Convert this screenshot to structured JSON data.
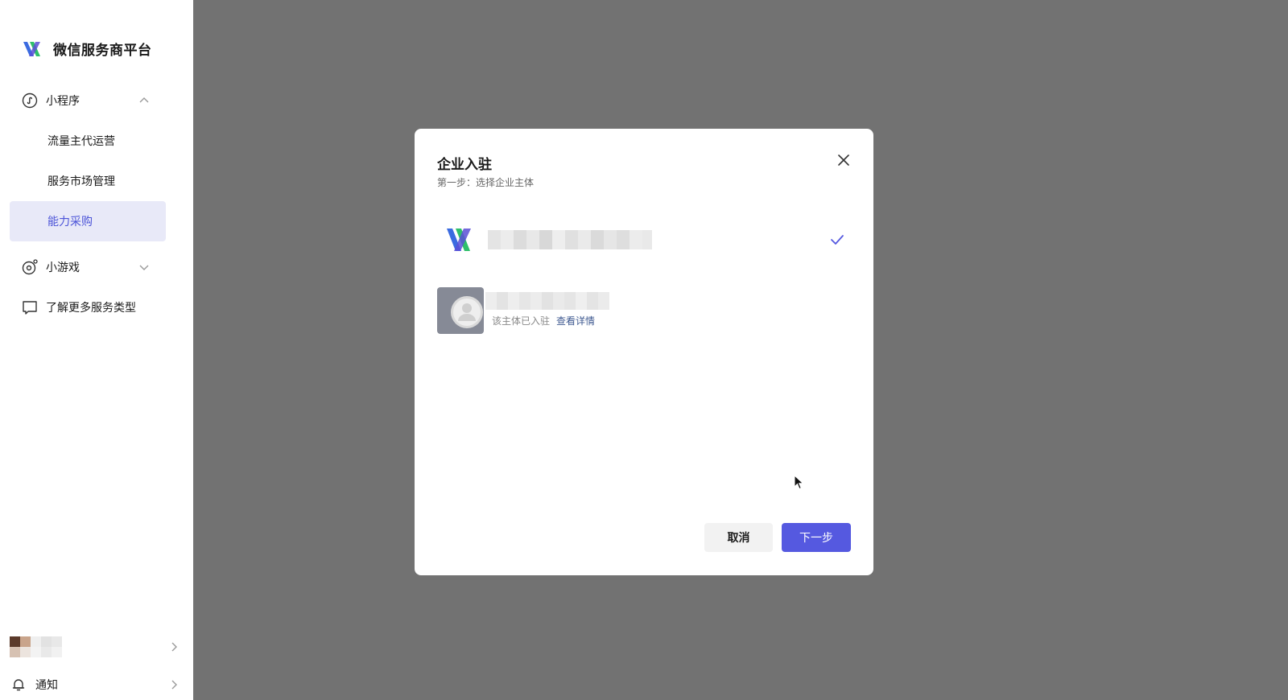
{
  "sidebar": {
    "brand": "微信服务商平台",
    "groups": [
      {
        "label": "小程序",
        "icon": "mini-program-icon",
        "expanded": true
      },
      {
        "label": "小游戏",
        "icon": "mini-game-icon",
        "expanded": false
      },
      {
        "label": "了解更多服务类型",
        "icon": "message-square-icon"
      }
    ],
    "sub_items": [
      {
        "label": "流量主代运营",
        "active": false
      },
      {
        "label": "服务市场管理",
        "active": false
      },
      {
        "label": "能力采购",
        "active": true
      }
    ],
    "notify_label": "通知"
  },
  "modal": {
    "title": "企业入驻",
    "subtitle": "第一步：选择企业主体",
    "entities": [
      {
        "selected": true,
        "status": ""
      },
      {
        "selected": false,
        "status": "该主体已入驻",
        "link": "查看详情"
      }
    ],
    "cancel_label": "取消",
    "next_label": "下一步"
  },
  "colors": {
    "accent": "#5559e0",
    "active_bg": "#e8e9f8",
    "overlay": "#727272",
    "link": "#3f5a91"
  }
}
